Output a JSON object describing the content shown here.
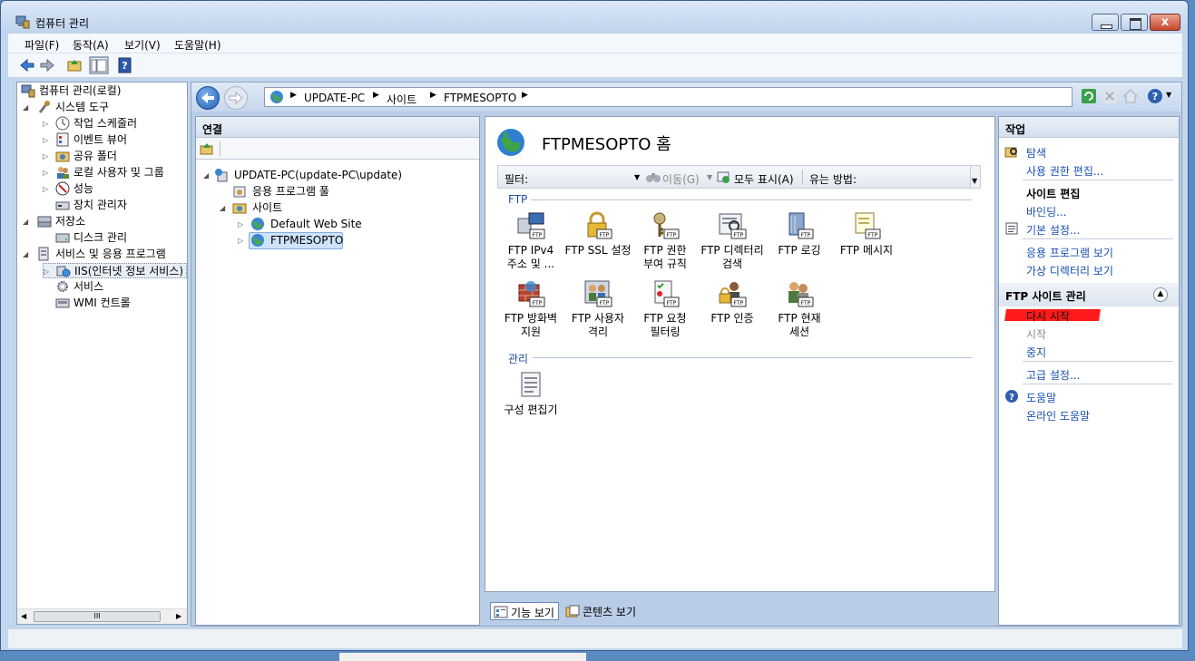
{
  "window": {
    "title": "컴퓨터 관리",
    "close_glyph": "x"
  },
  "menu": [
    "파일(F)",
    "동작(A)",
    "보기(V)",
    "도움말(H)"
  ],
  "left_tree": [
    {
      "label": "컴퓨터 관리(로컬)",
      "icon": "computer-management-icon"
    },
    {
      "label": "시스템 도구",
      "icon": "system-tools-icon"
    },
    {
      "label": "작업 스케줄러",
      "icon": "task-scheduler-icon"
    },
    {
      "label": "이벤트 뷰어",
      "icon": "event-viewer-icon"
    },
    {
      "label": "공유 폴더",
      "icon": "shared-folders-icon"
    },
    {
      "label": "로컬 사용자 및 그룹",
      "icon": "local-users-icon"
    },
    {
      "label": "성능",
      "icon": "performance-icon"
    },
    {
      "label": "장치 관리자",
      "icon": "device-manager-icon"
    },
    {
      "label": "저장소",
      "icon": "storage-icon"
    },
    {
      "label": "디스크 관리",
      "icon": "disk-management-icon"
    },
    {
      "label": "서비스 및 응용 프로그램",
      "icon": "services-apps-icon"
    },
    {
      "label": "IIS(인터넷 정보 서비스)",
      "icon": "iis-icon"
    },
    {
      "label": "서비스",
      "icon": "services-icon"
    },
    {
      "label": "WMI 컨트롤",
      "icon": "wmi-icon"
    }
  ],
  "left_scroll_glyph": "III",
  "breadcrumb": [
    "UPDATE-PC",
    "사이트",
    "FTPMESOPTO"
  ],
  "connections": {
    "header": "연결",
    "tree": [
      {
        "label": "UPDATE-PC(update-PC\\update)"
      },
      {
        "label": "응용 프로그램 풀"
      },
      {
        "label": "사이트"
      },
      {
        "label": "Default Web Site"
      },
      {
        "label": "FTPMESOPTO"
      }
    ]
  },
  "main": {
    "title": "FTPMESOPTO 홈",
    "filter_label": "필터:",
    "filter_value": "",
    "go_label": "이동(G)",
    "show_all_label": "모두 표시(A)",
    "group_by_label": "유는 방법:",
    "groups": [
      {
        "label": "FTP",
        "features": [
          {
            "line1": "FTP IPv4",
            "line2": "주소 및 ..."
          },
          {
            "line1": "FTP SSL 설정",
            "line2": ""
          },
          {
            "line1": "FTP 권한",
            "line2": "부여 규칙"
          },
          {
            "line1": "FTP 디렉터리",
            "line2": "검색"
          },
          {
            "line1": "FTP 로깅",
            "line2": ""
          },
          {
            "line1": "FTP 메시지",
            "line2": ""
          },
          {
            "line1": "FTP 방화벽",
            "line2": "지원"
          },
          {
            "line1": "FTP 사용자",
            "line2": "격리"
          },
          {
            "line1": "FTP 요청",
            "line2": "필터링"
          },
          {
            "line1": "FTP 인증",
            "line2": ""
          },
          {
            "line1": "FTP 현재",
            "line2": "세션"
          }
        ]
      },
      {
        "label": "관리",
        "features": [
          {
            "line1": "구성 편집기",
            "line2": ""
          }
        ]
      }
    ],
    "icon_badge": "FTP"
  },
  "view_tabs": [
    "기능 보기",
    "콘텐츠 보기"
  ],
  "actions": {
    "header": "작업",
    "explore": "탐색",
    "edit_permissions": "사용 권한 편집...",
    "edit_site_heading": "사이트 편집",
    "bindings": "바인딩...",
    "basic_settings": "기본 설정...",
    "view_applications": "응용 프로그램 보기",
    "view_virtual_dirs": "가상 디렉터리 보기",
    "manage_heading": "FTP 사이트 관리",
    "restart": "다시 시작",
    "start": "시작",
    "stop": "중지",
    "advanced_settings": "고급 설정...",
    "help": "도움말",
    "online_help": "온라인 도움말"
  },
  "colors": {
    "link": "#1a4fb0",
    "highlight_mark": "#ff1a1a",
    "selection": "#cde3fb"
  }
}
